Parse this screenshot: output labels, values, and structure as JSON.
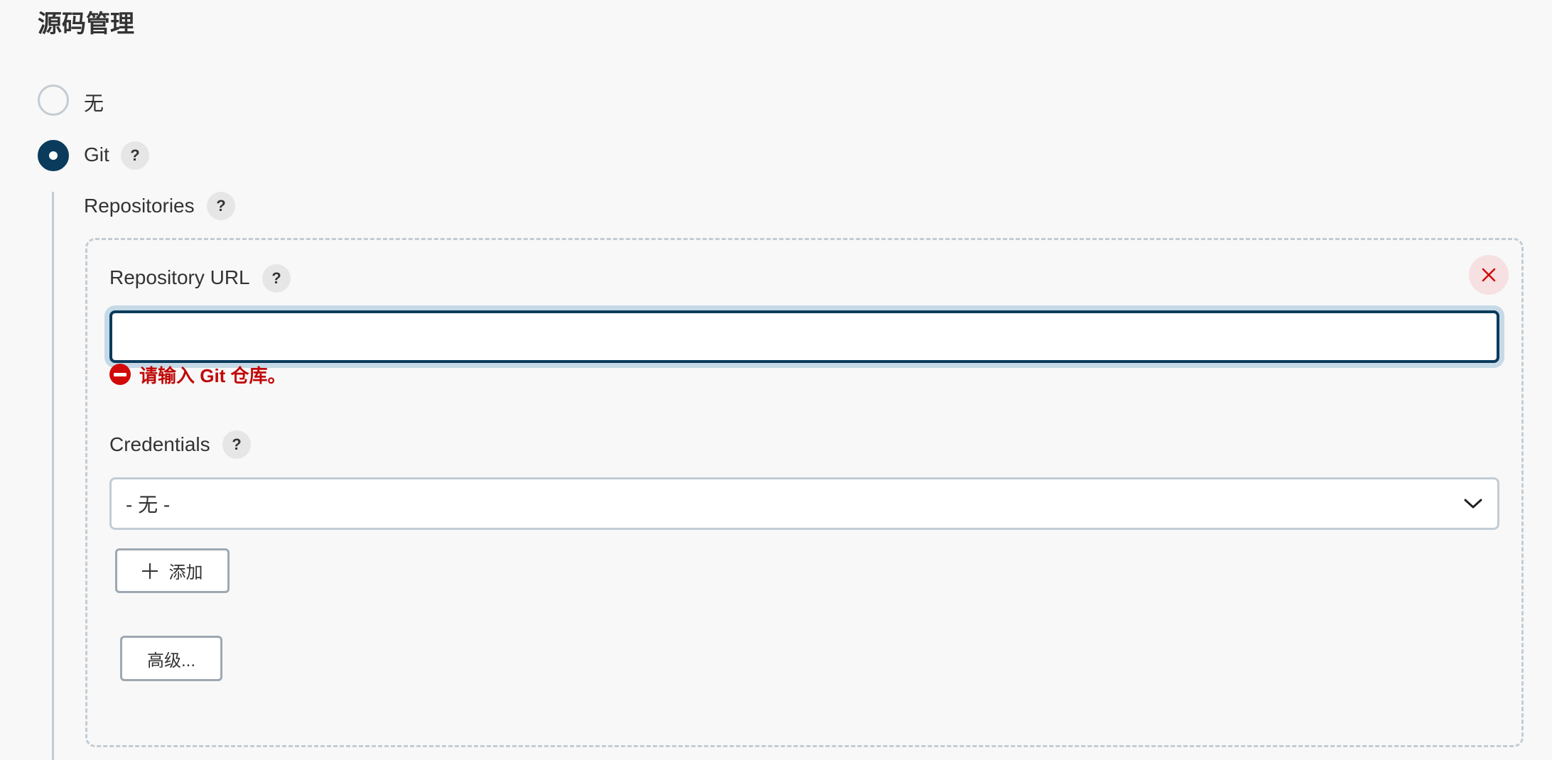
{
  "section": {
    "title": "源码管理"
  },
  "scm_options": {
    "none_label": "无",
    "git_label": "Git",
    "selected": "Git"
  },
  "help_label": "?",
  "repositories": {
    "label": "Repositories",
    "url_label": "Repository URL",
    "url_value": "",
    "error_message": "请输入 Git 仓库。",
    "credentials_label": "Credentials",
    "credentials_selected": "- 无 -",
    "add_button": "添加",
    "advanced_button": "高级..."
  },
  "colors": {
    "accent": "#0a3b5c",
    "error": "#c10707",
    "border": "#c3ccd4",
    "background": "#f8f8f8"
  },
  "icons": [
    "help-icon",
    "close-icon",
    "error-icon",
    "chevron-down-icon",
    "plus-icon"
  ]
}
